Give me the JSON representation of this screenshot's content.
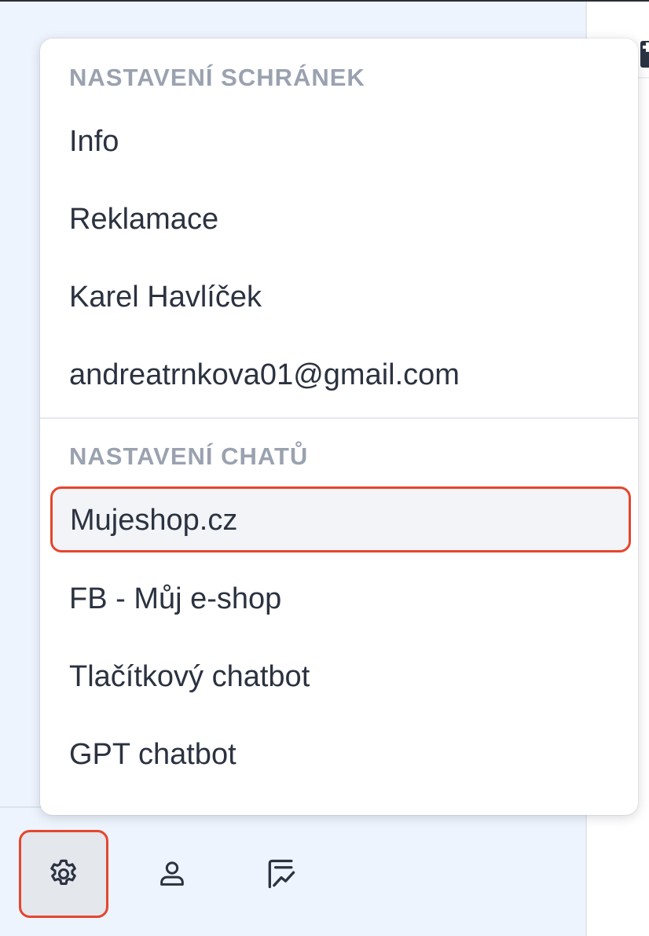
{
  "dropdown": {
    "mailbox_section": {
      "header": "NASTAVENÍ SCHRÁNEK",
      "items": [
        {
          "label": "Info"
        },
        {
          "label": "Reklamace"
        },
        {
          "label": "Karel Havlíček"
        },
        {
          "label": "andreatrnkova01@gmail.com"
        }
      ]
    },
    "chat_section": {
      "header": "NASTAVENÍ CHATŮ",
      "items": [
        {
          "label": "Mujeshop.cz",
          "selected": true
        },
        {
          "label": "FB - Můj e-shop"
        },
        {
          "label": "Tlačítkový chatbot"
        },
        {
          "label": "GPT chatbot"
        }
      ]
    }
  },
  "footer_nav": {
    "buttons": [
      {
        "icon": "gear-icon",
        "active": true
      },
      {
        "icon": "user-icon"
      },
      {
        "icon": "report-chart-icon"
      }
    ]
  },
  "colors": {
    "highlight_outline": "#e5462d",
    "section_header": "#9aa2b0",
    "item_text": "#2b3240",
    "sidebar_bg": "#eef4fd"
  }
}
